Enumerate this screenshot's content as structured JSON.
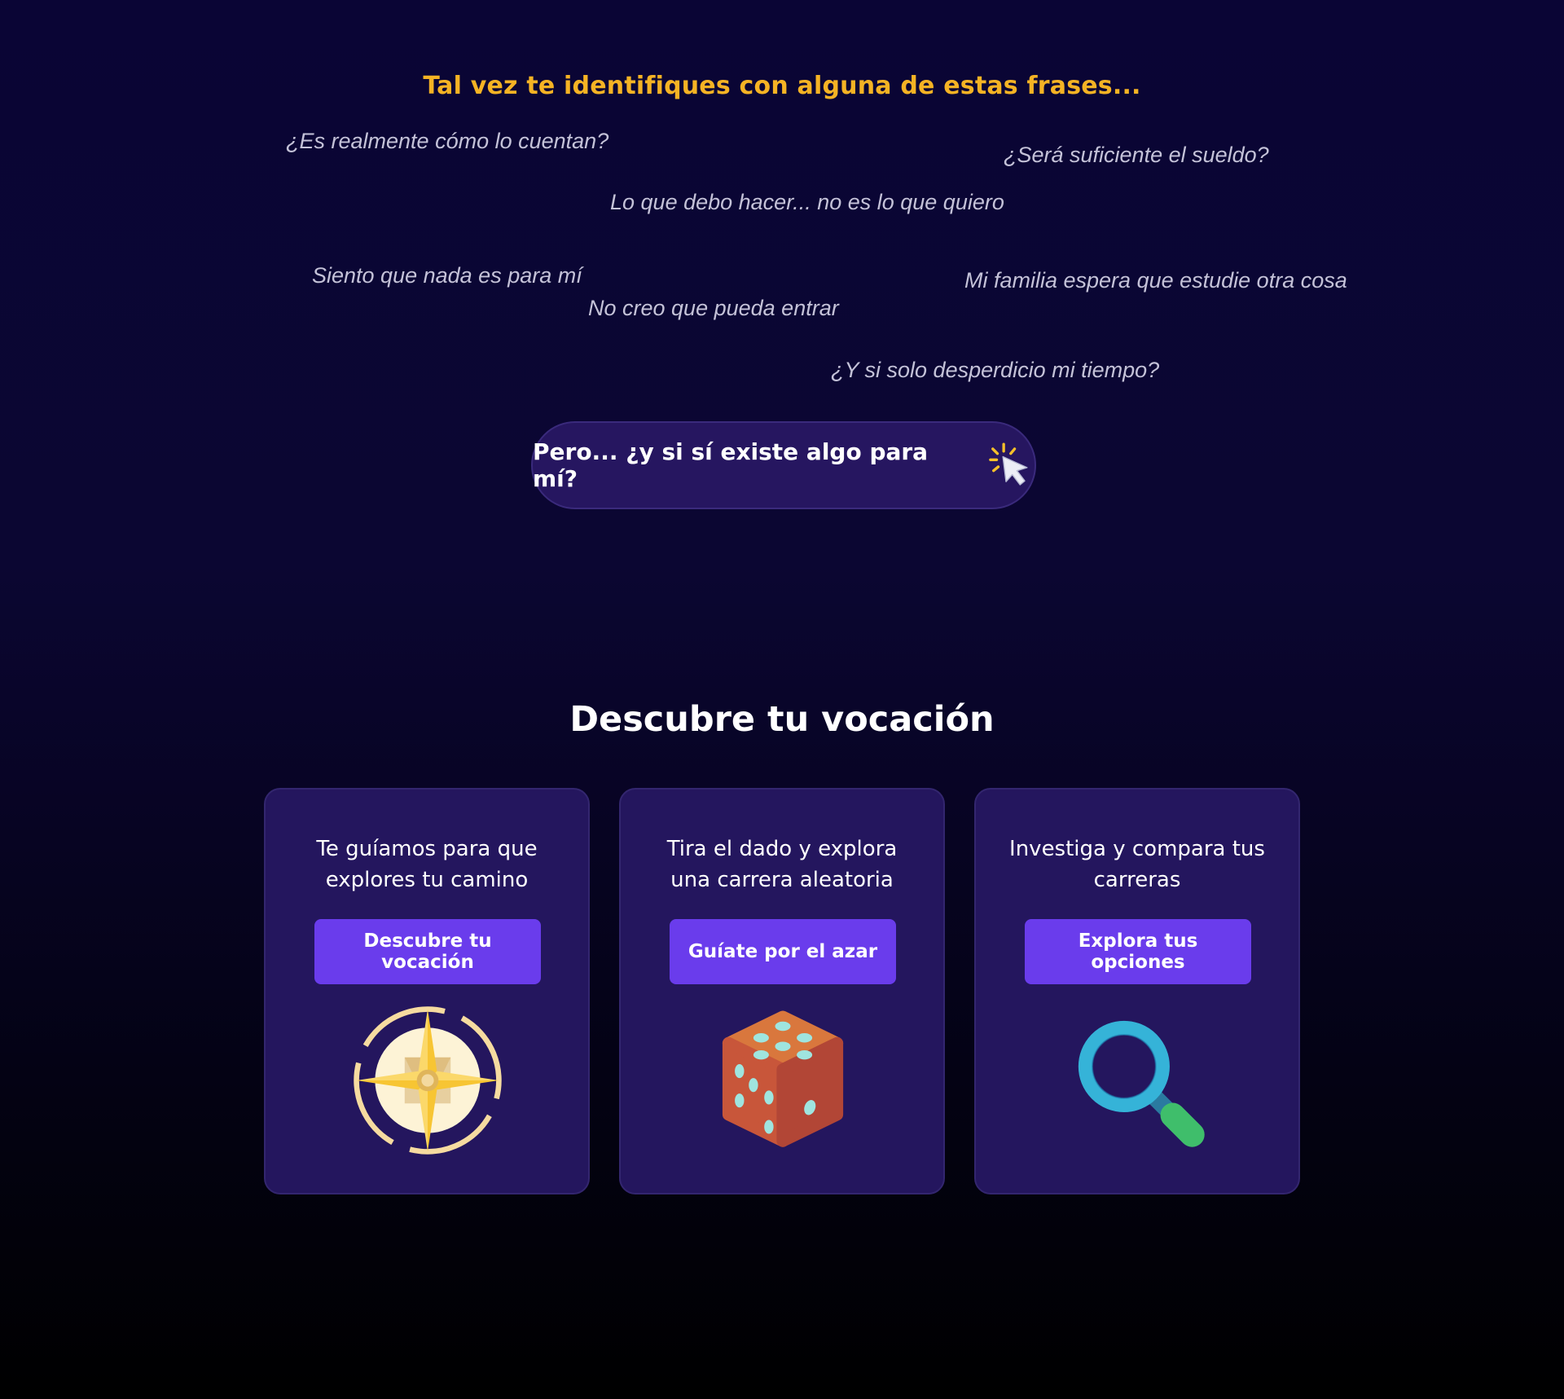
{
  "intro": {
    "heading": "Tal vez te identifiques con alguna de estas frases..."
  },
  "phrases": [
    "¿Es realmente cómo lo cuentan?",
    "¿Será suficiente el sueldo?",
    "Lo que debo hacer... no es lo que quiero",
    "Siento que nada es para mí",
    "Mi familia espera que estudie otra cosa",
    "No creo que pueda entrar",
    "¿Y si solo desperdicio mi tiempo?"
  ],
  "cta": {
    "label": "Pero... ¿y si sí existe algo para mí?",
    "icon": "cursor-click-icon"
  },
  "section": {
    "title": "Descubre tu vocación"
  },
  "cards": [
    {
      "text": "Te guíamos para que explores tu camino",
      "button": "Descubre tu vocación",
      "icon": "compass-icon"
    },
    {
      "text": "Tira el dado y explora una carrera aleatoria",
      "button": "Guíate por el azar",
      "icon": "dice-icon"
    },
    {
      "text": "Investiga y compara tus carreras",
      "button": "Explora tus opciones",
      "icon": "magnifier-icon"
    }
  ],
  "colors": {
    "accent_yellow": "#f5b324",
    "button_purple": "#6a3cec",
    "card_background": "#24165e",
    "page_background": "#0a0535"
  }
}
